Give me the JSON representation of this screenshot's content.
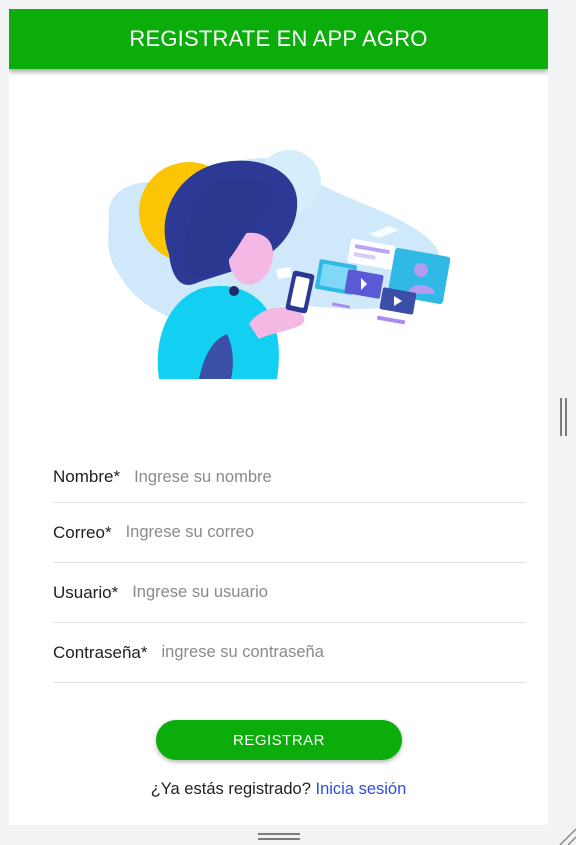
{
  "header": {
    "title": "REGISTRATE EN APP AGRO"
  },
  "illustration": {
    "icon": "person-browsing-media-illustration"
  },
  "form": {
    "fields": [
      {
        "label": "Nombre*",
        "placeholder": "Ingrese su nombre",
        "value": ""
      },
      {
        "label": "Correo*",
        "placeholder": "Ingrese su correo",
        "value": ""
      },
      {
        "label": "Usuario*",
        "placeholder": "Ingrese su usuario",
        "value": ""
      },
      {
        "label": "Contraseña*",
        "placeholder": "ingrese su contraseña",
        "value": ""
      }
    ]
  },
  "actions": {
    "register_label": "REGISTRAR",
    "login_prompt": "¿Ya estás registrado?",
    "login_link": "Inicia sesión"
  },
  "colors": {
    "brand_green": "#0aad0a",
    "link_blue": "#2d4de0"
  }
}
